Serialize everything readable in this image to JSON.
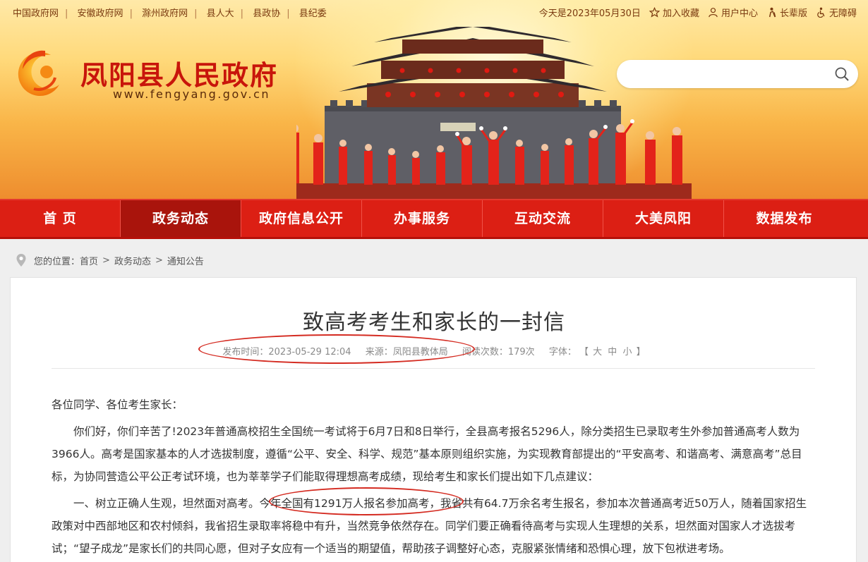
{
  "topbar": {
    "links": [
      "中国政府网",
      "安徽政府网",
      "滁州政府网",
      "县人大",
      "县政协",
      "县纪委"
    ],
    "date": "今天是2023年05月30日",
    "tools": [
      {
        "label": "加入收藏",
        "icon": "star-icon"
      },
      {
        "label": "用户中心",
        "icon": "user-icon"
      },
      {
        "label": "长辈版",
        "icon": "elder-icon"
      },
      {
        "label": "无障碍",
        "icon": "accessibility-icon"
      }
    ]
  },
  "header": {
    "title": "凤阳县人民政府",
    "url": "www.fengyang.gov.cn"
  },
  "search": {
    "placeholder": ""
  },
  "nav": {
    "items": [
      "首 页",
      "政务动态",
      "政府信息公开",
      "办事服务",
      "互动交流",
      "大美凤阳",
      "数据发布"
    ],
    "active": "政务动态"
  },
  "breadcrumb": {
    "prefix": "您的位置：",
    "items": [
      "首页",
      "政务动态",
      "通知公告"
    ],
    "separator": ">"
  },
  "article": {
    "title": "致高考考生和家长的一封信",
    "meta": {
      "time": "发布时间：2023-05-29 12:04",
      "source": "来源：凤阳县教体局",
      "reads": "阅读次数：179次",
      "font_label": "字体：",
      "font_open": "【",
      "font_sizes": [
        "大",
        "中",
        "小"
      ],
      "font_close": "】"
    },
    "paragraphs": [
      "各位同学、各位考生家长：",
      "你们好，你们辛苦了!2023年普通高校招生全国统一考试将于6月7日和8日举行，全县高考报名5296人，除分类招生已录取考生外参加普通高考人数为3966人。高考是国家基本的人才选拔制度，遵循“公平、安全、科学、规范”基本原则组织实施，为实现教育部提出的“平安高考、和谐高考、满意高考”总目标，为协同营造公平公正考试环境，也为莘莘学子们能取得理想高考成绩，现给考生和家长们提出如下几点建议：",
      "一、树立正确人生观，坦然面对高考。今年全国有1291万人报名参加高考，我省共有64.7万余名考生报名，参加本次普通高考近50万人，随着国家招生政策对中西部地区和农村倾斜，我省招生录取率将稳中有升，当然竞争依然存在。同学们要正确看待高考与实现人生理想的关系，坦然面对国家人才选拔考试；“望子成龙”是家长们的共同心愿，但对子女应有一个适当的期望值，帮助孩子调整好心态，克服紧张情绪和恐惧心理，放下包袱进考场。"
    ]
  },
  "colors": {
    "brand_red": "#dc1f14",
    "nav_active": "#a9140c",
    "annotation_red": "#d42a20"
  }
}
